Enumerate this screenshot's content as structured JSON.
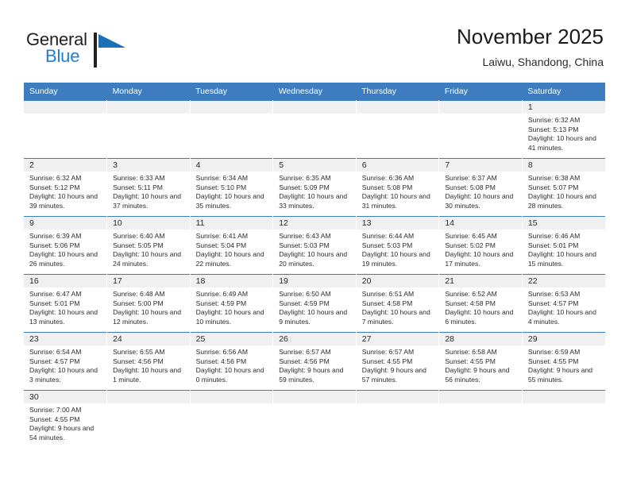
{
  "brand": {
    "name_line1": "General",
    "name_line2": "Blue",
    "mark": "triangle-flag-icon",
    "accent_color": "#1e7fd4"
  },
  "header": {
    "title": "November 2025",
    "subtitle": "Laiwu, Shandong, China"
  },
  "calendar": {
    "header_color": "#3d7cbf",
    "daynum_bg": "#f0f0f0",
    "weekday_headers": [
      "Sunday",
      "Monday",
      "Tuesday",
      "Wednesday",
      "Thursday",
      "Friday",
      "Saturday"
    ],
    "labels": {
      "sunrise": "Sunrise:",
      "sunset": "Sunset:",
      "daylight": "Daylight:"
    },
    "weeks": [
      [
        {
          "day": "",
          "empty": true
        },
        {
          "day": "",
          "empty": true
        },
        {
          "day": "",
          "empty": true
        },
        {
          "day": "",
          "empty": true
        },
        {
          "day": "",
          "empty": true
        },
        {
          "day": "",
          "empty": true
        },
        {
          "day": "1",
          "sunrise": "Sunrise: 6:32 AM",
          "sunset": "Sunset: 5:13 PM",
          "daylight": "Daylight: 10 hours and 41 minutes."
        }
      ],
      [
        {
          "day": "2",
          "sunrise": "Sunrise: 6:32 AM",
          "sunset": "Sunset: 5:12 PM",
          "daylight": "Daylight: 10 hours and 39 minutes."
        },
        {
          "day": "3",
          "sunrise": "Sunrise: 6:33 AM",
          "sunset": "Sunset: 5:11 PM",
          "daylight": "Daylight: 10 hours and 37 minutes."
        },
        {
          "day": "4",
          "sunrise": "Sunrise: 6:34 AM",
          "sunset": "Sunset: 5:10 PM",
          "daylight": "Daylight: 10 hours and 35 minutes."
        },
        {
          "day": "5",
          "sunrise": "Sunrise: 6:35 AM",
          "sunset": "Sunset: 5:09 PM",
          "daylight": "Daylight: 10 hours and 33 minutes."
        },
        {
          "day": "6",
          "sunrise": "Sunrise: 6:36 AM",
          "sunset": "Sunset: 5:08 PM",
          "daylight": "Daylight: 10 hours and 31 minutes."
        },
        {
          "day": "7",
          "sunrise": "Sunrise: 6:37 AM",
          "sunset": "Sunset: 5:08 PM",
          "daylight": "Daylight: 10 hours and 30 minutes."
        },
        {
          "day": "8",
          "sunrise": "Sunrise: 6:38 AM",
          "sunset": "Sunset: 5:07 PM",
          "daylight": "Daylight: 10 hours and 28 minutes."
        }
      ],
      [
        {
          "day": "9",
          "sunrise": "Sunrise: 6:39 AM",
          "sunset": "Sunset: 5:06 PM",
          "daylight": "Daylight: 10 hours and 26 minutes."
        },
        {
          "day": "10",
          "sunrise": "Sunrise: 6:40 AM",
          "sunset": "Sunset: 5:05 PM",
          "daylight": "Daylight: 10 hours and 24 minutes."
        },
        {
          "day": "11",
          "sunrise": "Sunrise: 6:41 AM",
          "sunset": "Sunset: 5:04 PM",
          "daylight": "Daylight: 10 hours and 22 minutes."
        },
        {
          "day": "12",
          "sunrise": "Sunrise: 6:43 AM",
          "sunset": "Sunset: 5:03 PM",
          "daylight": "Daylight: 10 hours and 20 minutes."
        },
        {
          "day": "13",
          "sunrise": "Sunrise: 6:44 AM",
          "sunset": "Sunset: 5:03 PM",
          "daylight": "Daylight: 10 hours and 19 minutes."
        },
        {
          "day": "14",
          "sunrise": "Sunrise: 6:45 AM",
          "sunset": "Sunset: 5:02 PM",
          "daylight": "Daylight: 10 hours and 17 minutes."
        },
        {
          "day": "15",
          "sunrise": "Sunrise: 6:46 AM",
          "sunset": "Sunset: 5:01 PM",
          "daylight": "Daylight: 10 hours and 15 minutes."
        }
      ],
      [
        {
          "day": "16",
          "sunrise": "Sunrise: 6:47 AM",
          "sunset": "Sunset: 5:01 PM",
          "daylight": "Daylight: 10 hours and 13 minutes."
        },
        {
          "day": "17",
          "sunrise": "Sunrise: 6:48 AM",
          "sunset": "Sunset: 5:00 PM",
          "daylight": "Daylight: 10 hours and 12 minutes."
        },
        {
          "day": "18",
          "sunrise": "Sunrise: 6:49 AM",
          "sunset": "Sunset: 4:59 PM",
          "daylight": "Daylight: 10 hours and 10 minutes."
        },
        {
          "day": "19",
          "sunrise": "Sunrise: 6:50 AM",
          "sunset": "Sunset: 4:59 PM",
          "daylight": "Daylight: 10 hours and 9 minutes."
        },
        {
          "day": "20",
          "sunrise": "Sunrise: 6:51 AM",
          "sunset": "Sunset: 4:58 PM",
          "daylight": "Daylight: 10 hours and 7 minutes."
        },
        {
          "day": "21",
          "sunrise": "Sunrise: 6:52 AM",
          "sunset": "Sunset: 4:58 PM",
          "daylight": "Daylight: 10 hours and 6 minutes."
        },
        {
          "day": "22",
          "sunrise": "Sunrise: 6:53 AM",
          "sunset": "Sunset: 4:57 PM",
          "daylight": "Daylight: 10 hours and 4 minutes."
        }
      ],
      [
        {
          "day": "23",
          "sunrise": "Sunrise: 6:54 AM",
          "sunset": "Sunset: 4:57 PM",
          "daylight": "Daylight: 10 hours and 3 minutes."
        },
        {
          "day": "24",
          "sunrise": "Sunrise: 6:55 AM",
          "sunset": "Sunset: 4:56 PM",
          "daylight": "Daylight: 10 hours and 1 minute."
        },
        {
          "day": "25",
          "sunrise": "Sunrise: 6:56 AM",
          "sunset": "Sunset: 4:56 PM",
          "daylight": "Daylight: 10 hours and 0 minutes."
        },
        {
          "day": "26",
          "sunrise": "Sunrise: 6:57 AM",
          "sunset": "Sunset: 4:56 PM",
          "daylight": "Daylight: 9 hours and 59 minutes."
        },
        {
          "day": "27",
          "sunrise": "Sunrise: 6:57 AM",
          "sunset": "Sunset: 4:55 PM",
          "daylight": "Daylight: 9 hours and 57 minutes."
        },
        {
          "day": "28",
          "sunrise": "Sunrise: 6:58 AM",
          "sunset": "Sunset: 4:55 PM",
          "daylight": "Daylight: 9 hours and 56 minutes."
        },
        {
          "day": "29",
          "sunrise": "Sunrise: 6:59 AM",
          "sunset": "Sunset: 4:55 PM",
          "daylight": "Daylight: 9 hours and 55 minutes."
        }
      ],
      [
        {
          "day": "30",
          "sunrise": "Sunrise: 7:00 AM",
          "sunset": "Sunset: 4:55 PM",
          "daylight": "Daylight: 9 hours and 54 minutes."
        },
        {
          "day": "",
          "empty": true
        },
        {
          "day": "",
          "empty": true
        },
        {
          "day": "",
          "empty": true
        },
        {
          "day": "",
          "empty": true
        },
        {
          "day": "",
          "empty": true
        },
        {
          "day": "",
          "empty": true
        }
      ]
    ]
  }
}
